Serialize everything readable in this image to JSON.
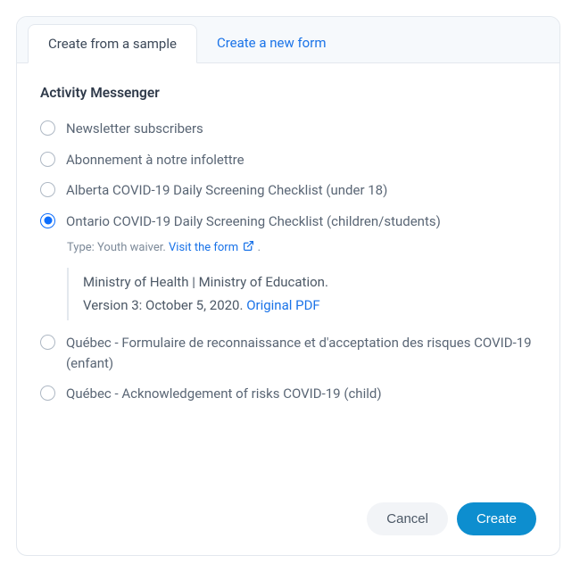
{
  "tabs": [
    {
      "label": "Create from a sample",
      "active": true
    },
    {
      "label": "Create a new form",
      "active": false
    }
  ],
  "section_title": "Activity Messenger",
  "options": [
    {
      "label": "Newsletter subscribers",
      "selected": false
    },
    {
      "label": "Abonnement à notre infolettre",
      "selected": false
    },
    {
      "label": "Alberta COVID-19 Daily Screening Checklist (under 18)",
      "selected": false
    },
    {
      "label": "Ontario COVID-19 Daily Screening Checklist (children/students)",
      "selected": true
    },
    {
      "label": "Québec - Formulaire de reconnaissance et d'acceptation des risques COVID-19 (enfant)",
      "selected": false
    },
    {
      "label": "Québec - Acknowledgement of risks COVID-19 (child)",
      "selected": false
    }
  ],
  "selected_details": {
    "type_label": "Type: Youth waiver.",
    "visit_link": "Visit the form",
    "desc_line1": "Ministry of Health | Ministry of Education.",
    "desc_line2": "Version 3: October 5, 2020.",
    "original_pdf": "Original PDF"
  },
  "footer": {
    "cancel": "Cancel",
    "create": "Create"
  }
}
